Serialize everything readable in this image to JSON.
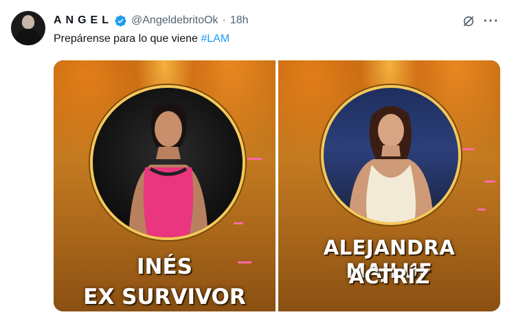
{
  "user": {
    "display_name": "ANGEL",
    "handle": "@AngeldebritoOk",
    "separator": "·",
    "time": "18h"
  },
  "tweet": {
    "text": "Prepárense para lo que viene ",
    "hashtag": "#LAM"
  },
  "icons": {
    "verified": "verified-badge-icon",
    "grok": "grok-icon",
    "more": "more-icon"
  },
  "colors": {
    "accent": "#1d9bf0",
    "text": "#0f1419",
    "muted": "#536471",
    "ring": "#f4c85a"
  },
  "media": {
    "panels": [
      {
        "line1": "INÉS",
        "line2": "EX SURVIVOR"
      },
      {
        "line1": "ALEJANDRA MAJLUF",
        "line2": "ACTRÍZ"
      }
    ]
  }
}
